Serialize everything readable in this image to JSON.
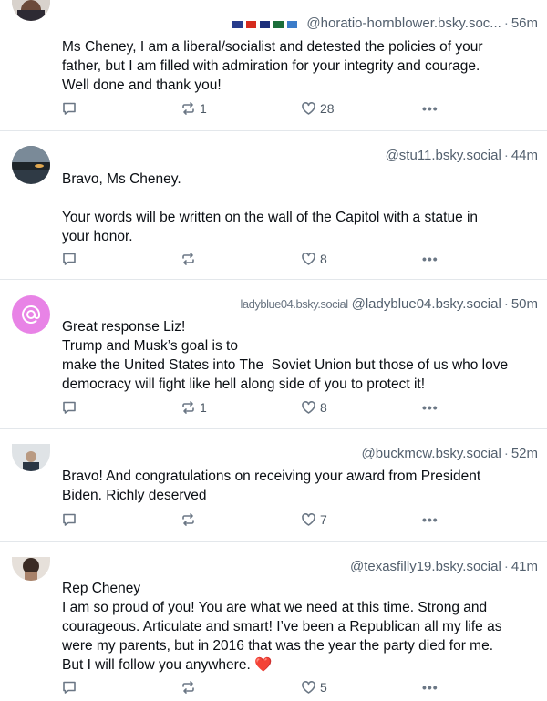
{
  "posts": [
    {
      "handle": "@horatio-hornblower.bsky.soc...",
      "time": "56m",
      "lines": [
        "Ms Cheney, I am a liberal/socialist and detested the policies of your",
        "father, but I am filled with admiration for your integrity and courage.",
        "Well done and thank you!"
      ],
      "reposts": "1",
      "likes": "28"
    },
    {
      "handle": "@stu11.bsky.social",
      "time": "44m",
      "lines": [
        "Bravo, Ms Cheney.",
        "",
        "Your words will be written on the wall of the Capitol with a statue in",
        "your honor."
      ],
      "reposts": "",
      "likes": "8"
    },
    {
      "display_name_partial": "ladyblue04.bsky.social",
      "handle": "@ladyblue04.bsky.social",
      "time": "50m",
      "lines": [
        "Great response Liz!",
        "Trump and Musk’s goal is to",
        "make the United States into The  Soviet Union but those of us who love",
        "democracy will fight like hell along side of you to protect it!"
      ],
      "reposts": "1",
      "likes": "8"
    },
    {
      "handle": "@buckmcw.bsky.social",
      "time": "52m",
      "lines": [
        "Bravo! And congratulations on receiving your award from President",
        "Biden. Richly deserved"
      ],
      "reposts": "",
      "likes": "7"
    },
    {
      "handle": "@texasfilly19.bsky.social",
      "time": "41m",
      "lines": [
        "Rep Cheney",
        "I am so proud of you! You are what we need at this time. Strong and",
        "courageous. Articulate and smart! I’ve been a Republican all my life as",
        "were my parents, but in 2016 that was the year the party died for me.",
        "But I will follow you anywhere. ❤️"
      ],
      "reposts": "",
      "likes": "5"
    }
  ],
  "separator": "·",
  "more_glyph": "•••",
  "colors": {
    "text": "#0b0f14",
    "muted": "#53606e",
    "divider": "#e3e7eb",
    "avatar_at": "#e883e6"
  },
  "icons": [
    "reply-icon",
    "repost-icon",
    "like-icon",
    "more-icon",
    "at-sign-icon"
  ]
}
